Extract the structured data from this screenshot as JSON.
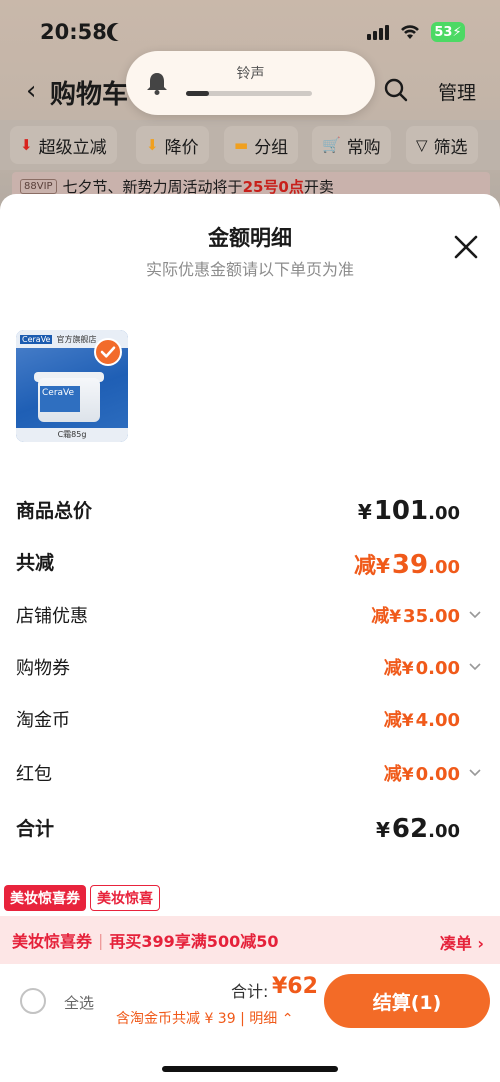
{
  "status": {
    "time": "20:58",
    "battery": "53"
  },
  "header": {
    "back_icon": "chevron-left-icon",
    "title": "购物车",
    "manage_label": "管理"
  },
  "filters": [
    {
      "label": "超级立减",
      "icon": "arrow-down-icon",
      "color": "#d8231e"
    },
    {
      "label": "降价",
      "icon": "arrow-down-icon",
      "color": "#f0a020"
    },
    {
      "label": "分组",
      "icon": "folder-icon",
      "color": "#f0a020"
    },
    {
      "label": "常购",
      "icon": "cart-icon",
      "color": "#f0a020"
    },
    {
      "label": "筛选",
      "icon": "filter-icon",
      "color": "#1a1a1a"
    }
  ],
  "promo": {
    "vip": "88VIP",
    "text_before": "七夕节、新势力周活动将于",
    "highlight": "25号0点",
    "text_after": "开卖"
  },
  "hud": {
    "label": "铃声",
    "level": 0.18
  },
  "sheet": {
    "title": "金额明细",
    "subtitle": "实际优惠金额请以下单页为准",
    "product": {
      "brand": "CeraVe",
      "store": "官方旗舰店",
      "size": "C霜85g",
      "selected": true
    },
    "rows": [
      {
        "label": "商品总价",
        "prefix": "",
        "currency": "¥",
        "int": "101",
        "dec": ".00",
        "bold": true,
        "orange": false,
        "chevron": false
      },
      {
        "label": "共减",
        "prefix": "减",
        "currency": "¥",
        "int": "39",
        "dec": ".00",
        "bold": true,
        "orange": true,
        "chevron": false
      },
      {
        "label": "店铺优惠",
        "prefix": "减",
        "currency": "¥",
        "int": "35",
        "dec": ".00",
        "bold": false,
        "orange": true,
        "chevron": true
      },
      {
        "label": "购物券",
        "prefix": "减",
        "currency": "¥",
        "int": "0",
        "dec": ".00",
        "bold": false,
        "orange": true,
        "chevron": true
      },
      {
        "label": "淘金币",
        "prefix": "减",
        "currency": "¥",
        "int": "4",
        "dec": ".00",
        "bold": false,
        "orange": true,
        "chevron": false
      },
      {
        "label": "红包",
        "prefix": "减",
        "currency": "¥",
        "int": "0",
        "dec": ".00",
        "bold": false,
        "orange": true,
        "chevron": true
      },
      {
        "label": "合计",
        "prefix": "",
        "currency": "¥",
        "int": "62",
        "dec": ".00",
        "bold": true,
        "orange": false,
        "chevron": false
      }
    ]
  },
  "coupon": {
    "tag1": "美妆惊喜券",
    "tag2": "美妆惊喜",
    "name": "美妆惊喜券",
    "offer": "再买399享满500减50",
    "more": "凑单 ›"
  },
  "checkout": {
    "select_all": "全选",
    "total_label": "合计:",
    "total_value": "¥62",
    "savings": "含淘金币共减 ¥ 39 | 明细",
    "pay_label": "结算(1)"
  },
  "colors": {
    "accent": "#f36b27",
    "price_orange": "#f05a1a",
    "coupon_red": "#e8233c"
  }
}
